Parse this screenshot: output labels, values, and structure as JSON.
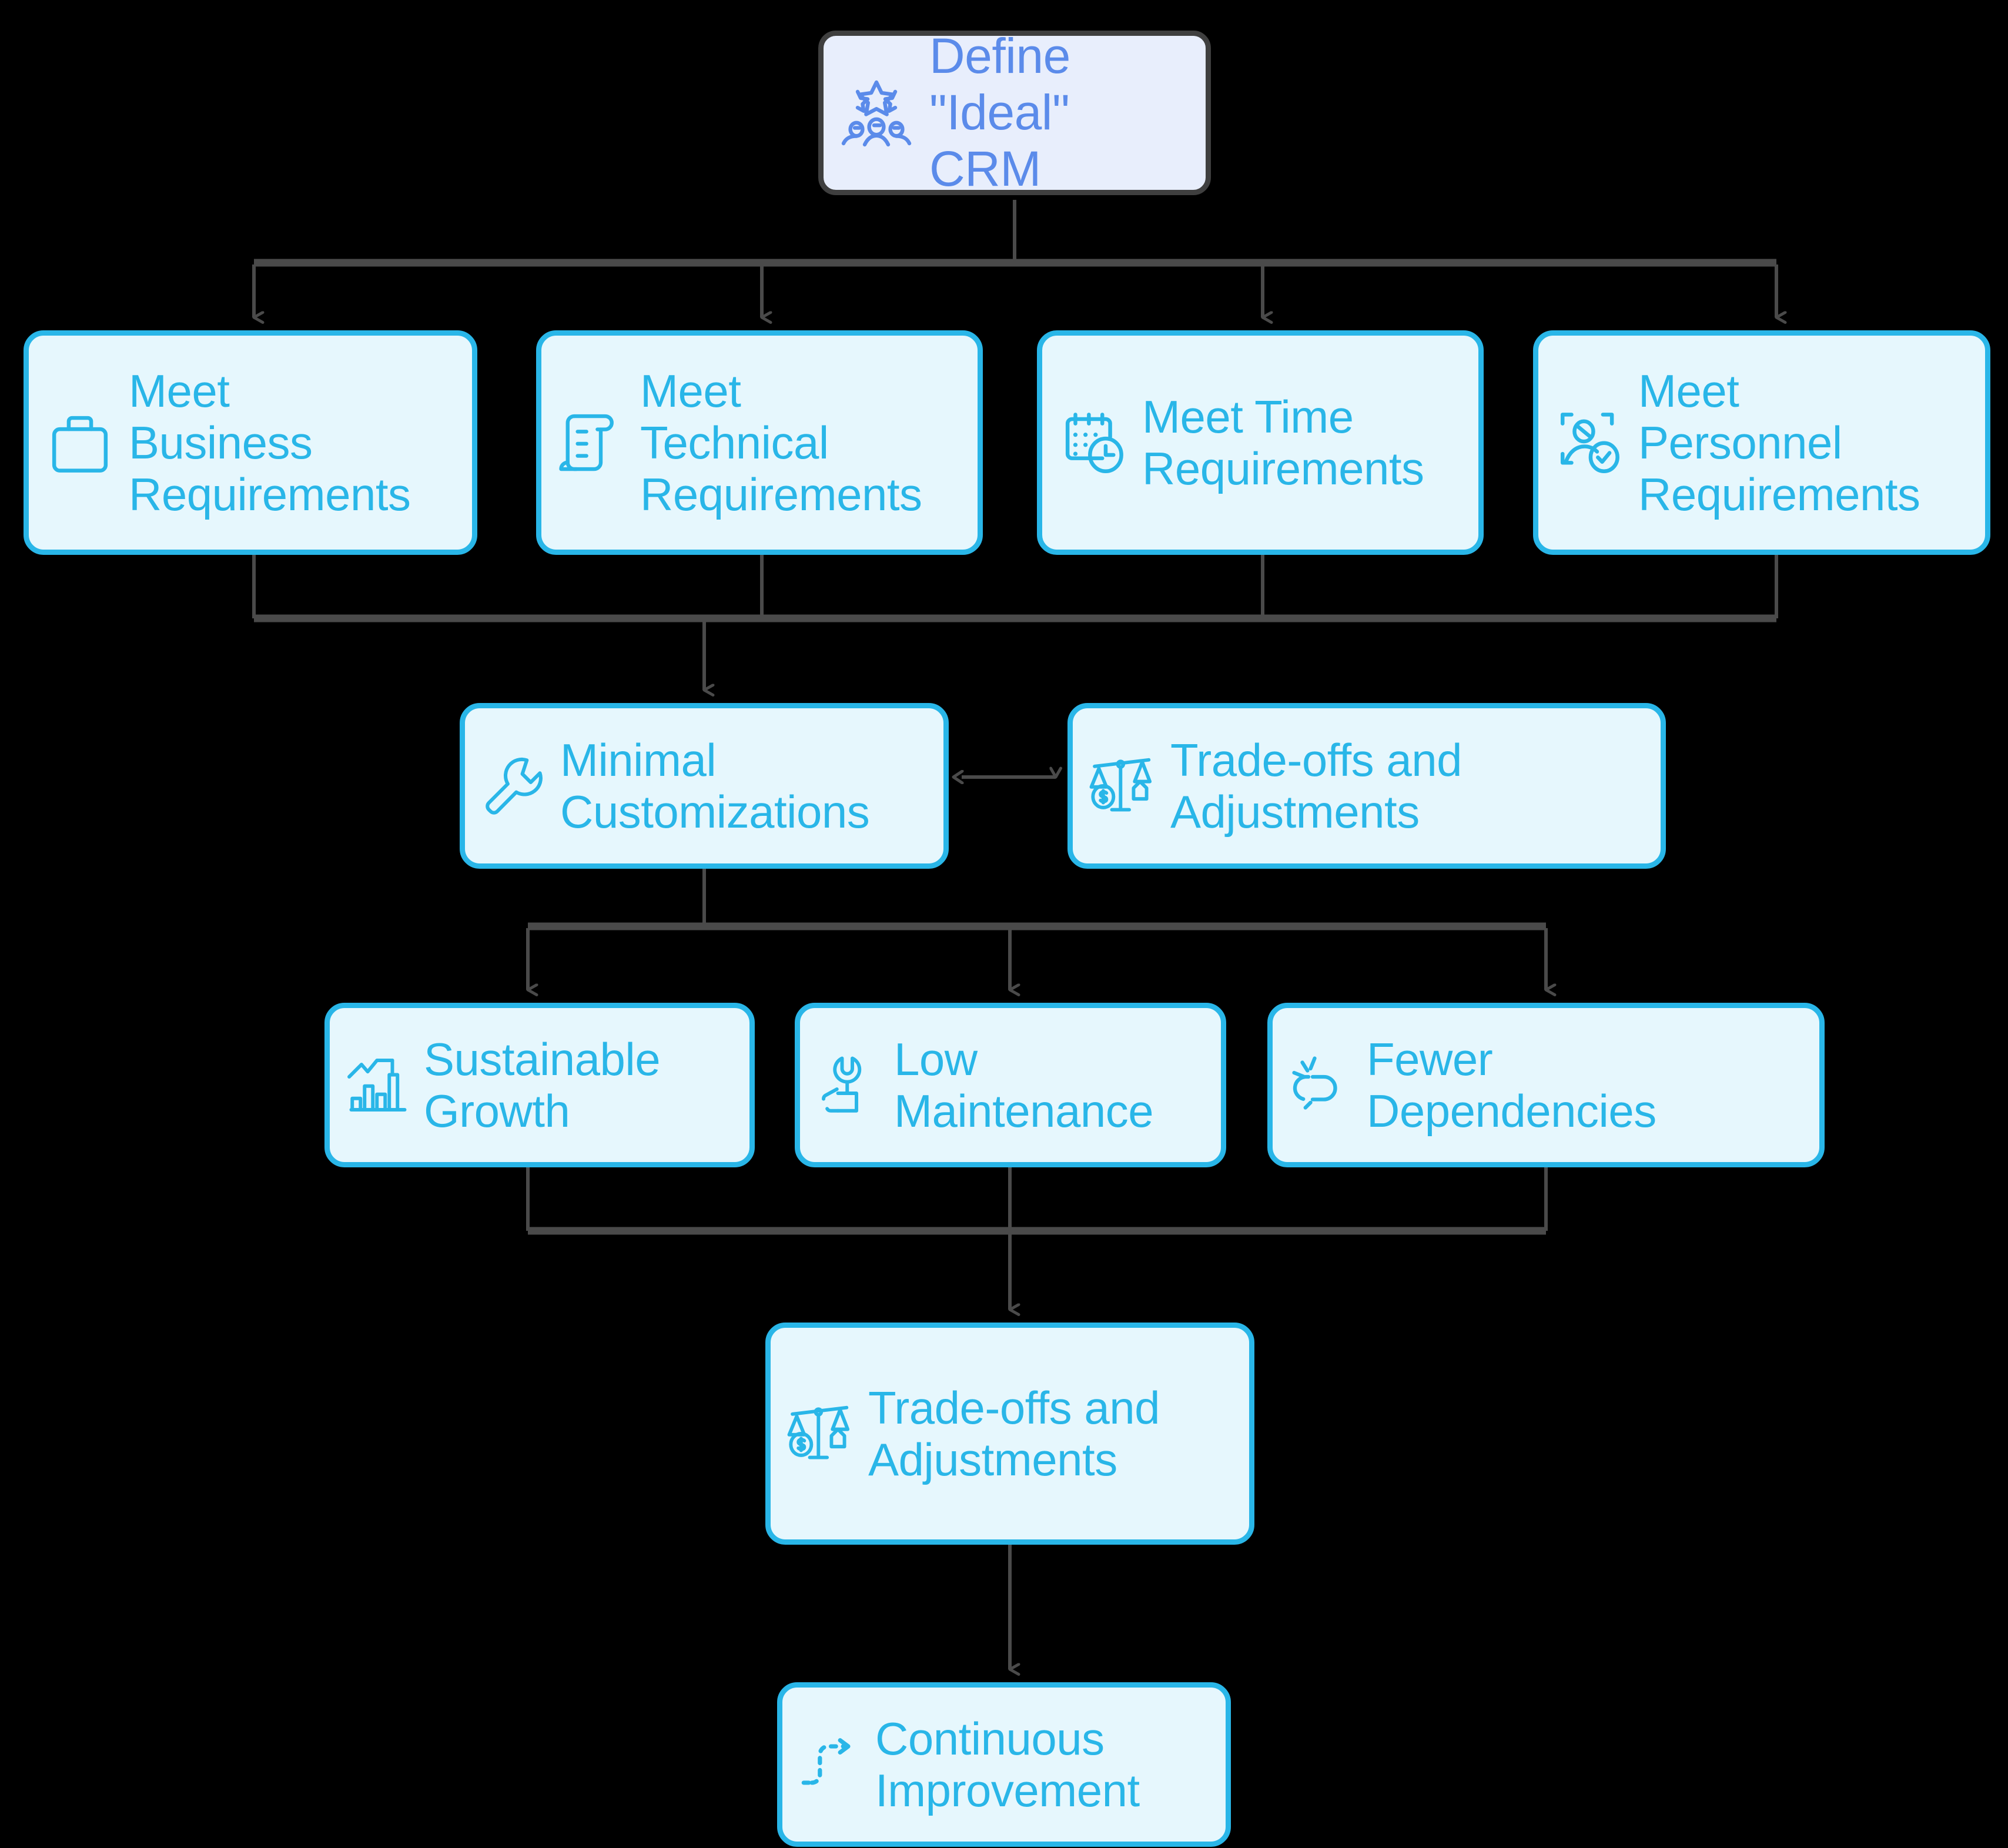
{
  "diagram": {
    "title": "CRM Requirements and Trade-offs Flowchart",
    "background_color": "#000000",
    "root_node_fill": "#e8eefc",
    "root_node_border": "#3f3f3f",
    "root_node_text_color": "#5b8bea",
    "node_fill": "#e6f7fd",
    "node_border": "#29b6e8",
    "node_text_color": "#29b6e8",
    "connector_color": "#4a4a4a"
  },
  "nodes": {
    "root": {
      "label": "Define\n\"Ideal\" CRM",
      "icon": "stars-team-icon"
    },
    "business": {
      "label": "Meet\nBusiness\nRequirements",
      "icon": "briefcase-icon"
    },
    "technical": {
      "label": "Meet\nTechnical\nRequirements",
      "icon": "scroll-document-icon"
    },
    "time": {
      "label": "Meet Time\nRequirements",
      "icon": "calendar-clock-icon"
    },
    "personnel": {
      "label": "Meet\nPersonnel\nRequirements",
      "icon": "person-verified-icon"
    },
    "minimal": {
      "label": "Minimal\nCustomizations",
      "icon": "wrench-icon"
    },
    "tradeoff1": {
      "label": "Trade-offs and\nAdjustments",
      "icon": "balance-scale-icon"
    },
    "growth": {
      "label": "Sustainable\nGrowth",
      "icon": "growth-chart-icon"
    },
    "lowmaint": {
      "label": "Low\nMaintenance",
      "icon": "hand-wrench-icon"
    },
    "fewerdep": {
      "label": "Fewer\nDependencies",
      "icon": "broken-link-icon"
    },
    "tradeoff2": {
      "label": "Trade-offs and\nAdjustments",
      "icon": "balance-scale-icon"
    },
    "improve": {
      "label": "Continuous\nImprovement",
      "icon": "dashed-arrow-icon"
    }
  },
  "edges": [
    {
      "from": "root",
      "to": "business",
      "type": "arrow"
    },
    {
      "from": "root",
      "to": "technical",
      "type": "arrow"
    },
    {
      "from": "root",
      "to": "time",
      "type": "arrow"
    },
    {
      "from": "root",
      "to": "personnel",
      "type": "arrow"
    },
    {
      "from": "business",
      "to": "minimal",
      "type": "arrow"
    },
    {
      "from": "technical",
      "to": "minimal",
      "type": "arrow"
    },
    {
      "from": "time",
      "to": "minimal",
      "type": "arrow"
    },
    {
      "from": "personnel",
      "to": "minimal",
      "type": "arrow"
    },
    {
      "from": "minimal",
      "to": "tradeoff1",
      "type": "double-arrow"
    },
    {
      "from": "minimal",
      "to": "growth",
      "type": "arrow"
    },
    {
      "from": "minimal",
      "to": "lowmaint",
      "type": "arrow"
    },
    {
      "from": "minimal",
      "to": "fewerdep",
      "type": "arrow"
    },
    {
      "from": "growth",
      "to": "tradeoff2",
      "type": "arrow"
    },
    {
      "from": "lowmaint",
      "to": "tradeoff2",
      "type": "arrow"
    },
    {
      "from": "fewerdep",
      "to": "tradeoff2",
      "type": "arrow"
    },
    {
      "from": "tradeoff2",
      "to": "improve",
      "type": "arrow"
    }
  ]
}
